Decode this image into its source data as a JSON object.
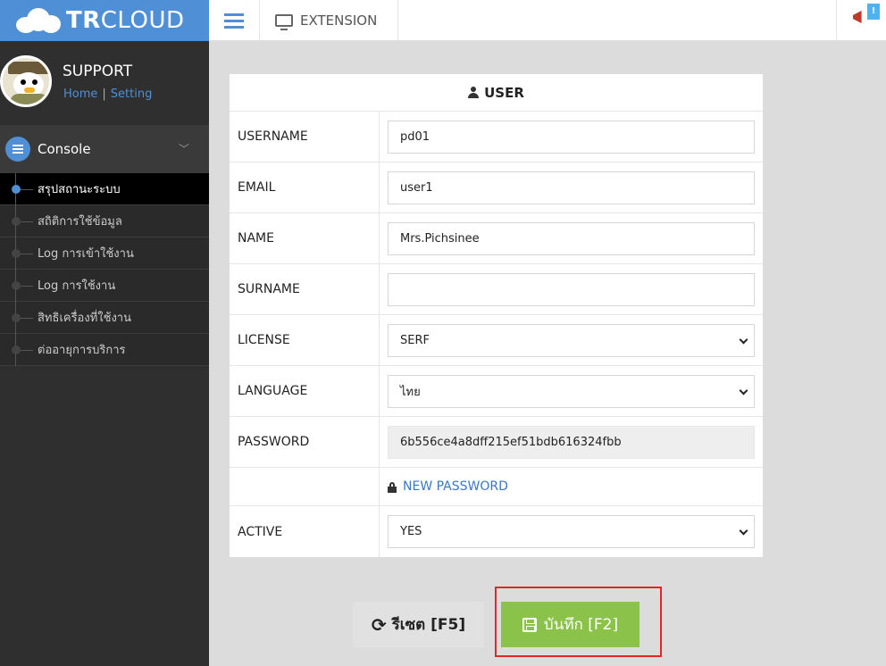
{
  "brand": {
    "name_bold": "TR",
    "name_rest": "CLOUD"
  },
  "topbar": {
    "extension_label": "EXTENSION",
    "notify_badge": "!"
  },
  "profile": {
    "name": "SUPPORT",
    "home_link": "Home",
    "separator": "|",
    "setting_link": "Setting"
  },
  "console": {
    "label": "Console",
    "chevron": "﹀"
  },
  "menu": {
    "items": [
      {
        "label": "สรุปสถานะระบบ",
        "active": true
      },
      {
        "label": "สถิติการใช้ข้อมูล",
        "active": false
      },
      {
        "label": "Log การเข้าใช้งาน",
        "active": false
      },
      {
        "label": "Log การใช้งาน",
        "active": false
      },
      {
        "label": "สิทธิเครื่องที่ใช้งาน",
        "active": false
      },
      {
        "label": "ต่ออายุการบริการ",
        "active": false
      }
    ]
  },
  "form": {
    "title": "USER",
    "username": {
      "label": "USERNAME",
      "value": "pd01"
    },
    "email": {
      "label": "EMAIL",
      "value": "user1"
    },
    "name": {
      "label": "NAME",
      "value": "Mrs.Pichsinee"
    },
    "surname": {
      "label": "SURNAME",
      "value": ""
    },
    "license": {
      "label": "LICENSE",
      "value": "SERF"
    },
    "language": {
      "label": "LANGUAGE",
      "value": "ไทย"
    },
    "password": {
      "label": "PASSWORD",
      "value": "6b556ce4a8dff215ef51bdb616324fbb"
    },
    "new_password_link": "NEW PASSWORD",
    "active": {
      "label": "ACTIVE",
      "value": "YES"
    }
  },
  "buttons": {
    "reset": "รีเซต [F5]",
    "save": "บันทึก [F2]"
  },
  "colors": {
    "brand_blue": "#4f8fd6",
    "save_green": "#8bc34a",
    "highlight_red": "#e3262a",
    "sidebar_dark": "#2f2f2f"
  }
}
